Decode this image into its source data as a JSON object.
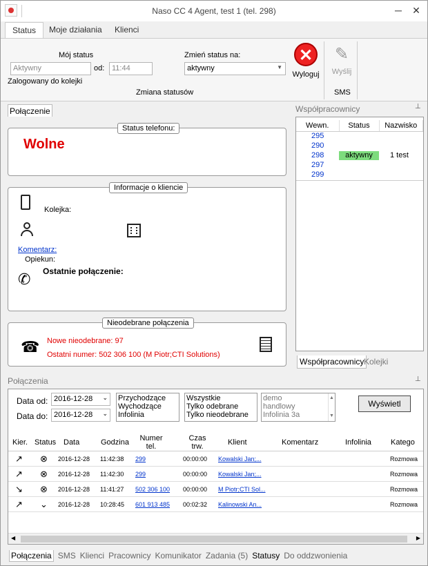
{
  "window": {
    "title": "Naso CC 4 Agent, test 1 (tel. 298)",
    "minimize": "─",
    "close": "✕"
  },
  "tabs": [
    {
      "label": "Status"
    },
    {
      "label": "Moje działania"
    },
    {
      "label": "Klienci"
    }
  ],
  "status": {
    "my_status_label": "Mój status",
    "my_status_value": "Aktywny",
    "from_label": "od:",
    "from_value": "11:44",
    "logged_label": "Zalogowany do kolejki",
    "change_label": "Zmień status na:",
    "change_value": "aktywny",
    "logout_label": "Wyloguj",
    "group_label": "Zmiana statusów",
    "send_label": "Wyślij",
    "sms_label": "SMS"
  },
  "connection": {
    "tab": "Połączenie",
    "phone_status_legend": "Status telefonu:",
    "phone_status": "Wolne",
    "client_legend": "Informacje o kliencie",
    "queue_label": "Kolejka:",
    "comment_label": "Komentarz:",
    "keeper_label": "Opiekun:",
    "last_call_label": "Ostatnie połączenie:",
    "missed_legend": "Nieodebrane połączenia",
    "missed_new": "Nowe nieodebrane: 97",
    "missed_last": "Ostatni numer: 502 306 100 (M Piotr;CTI Solutions)"
  },
  "coworkers": {
    "title": "Współpracownicy",
    "pin": "⊥",
    "headers": [
      "Wewn.",
      "Status",
      "Nazwisko"
    ],
    "rows": [
      [
        "295",
        "",
        ""
      ],
      [
        "290",
        "",
        ""
      ],
      [
        "298",
        "aktywny",
        "1 test"
      ],
      [
        "297",
        "",
        ""
      ],
      [
        "299",
        "",
        ""
      ]
    ],
    "tab_active": "Współpracownicy",
    "tab_other": "Kolejki",
    "active_color": "#7ddc7d"
  },
  "calls": {
    "title": "Połączenia",
    "date_from_label": "Data od:",
    "date_from": "2016-12-28",
    "date_to_label": "Data do:",
    "date_to": "2016-12-28",
    "directions": [
      "Przychodzące",
      "Wychodzące",
      "Infolinia"
    ],
    "filters": [
      "Wszystkie",
      "Tylko odebrane",
      "Tylko nieodebrane"
    ],
    "lines": [
      "demo",
      "handlowy",
      "Infolinia 3a"
    ],
    "show_button": "Wyświetl",
    "headers": [
      "Kier.",
      "Status",
      "Data",
      "Godzina",
      "Numer tel.",
      "Czas trw.",
      "Klient",
      "Komentarz",
      "Infolinia",
      "Katego"
    ],
    "rows": [
      {
        "dir": "↗",
        "status": "⊗",
        "date": "2016-12-28",
        "time": "11:42:38",
        "number": "299",
        "dur": "00:00:00",
        "client": "Kowalski Jan;...",
        "cat": "Rozmowa"
      },
      {
        "dir": "↗",
        "status": "⊗",
        "date": "2016-12-28",
        "time": "11:42:30",
        "number": "299",
        "dur": "00:00:00",
        "client": "Kowalski Jan;...",
        "cat": "Rozmowa"
      },
      {
        "dir": "↘",
        "status": "⊗",
        "date": "2016-12-28",
        "time": "11:41:27",
        "number": "502 306 100",
        "dur": "00:00:00",
        "client": "M Piotr;CTI Sol...",
        "cat": "Rozmowa"
      },
      {
        "dir": "↗",
        "status": "⌄",
        "date": "2016-12-28",
        "time": "10:28:45",
        "number": "601 913 485",
        "dur": "00:02:32",
        "client": "Kalinowski An...",
        "cat": "Rozmowa"
      }
    ]
  },
  "bottom_tabs": [
    "Połączenia",
    "SMS",
    "Klienci",
    "Pracownicy",
    "Komunikator",
    "Zadania (5)",
    "Statusy",
    "Do oddzwonienia"
  ]
}
